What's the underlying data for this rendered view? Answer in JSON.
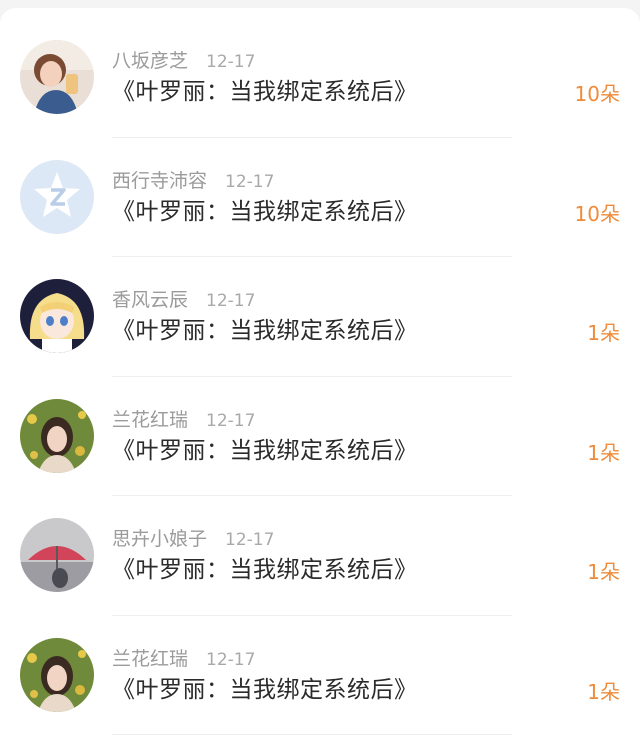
{
  "items": [
    {
      "name": "八坂彦芝",
      "date": "12-17",
      "book": "《叶罗丽：当我绑定系统后》",
      "amount": "10朵",
      "avatar_icon": "girl-photo-avatar"
    },
    {
      "name": "西行寺沛容",
      "date": "12-17",
      "book": "《叶罗丽：当我绑定系统后》",
      "amount": "10朵",
      "avatar_icon": "default-z-avatar"
    },
    {
      "name": "香风云辰",
      "date": "12-17",
      "book": "《叶罗丽：当我绑定系统后》",
      "amount": "1朵",
      "avatar_icon": "anime-girl-avatar"
    },
    {
      "name": "兰花红瑞",
      "date": "12-17",
      "book": "《叶罗丽：当我绑定系统后》",
      "amount": "1朵",
      "avatar_icon": "girl-flowers-avatar"
    },
    {
      "name": "思卉小娘子",
      "date": "12-17",
      "book": "《叶罗丽：当我绑定系统后》",
      "amount": "1朵",
      "avatar_icon": "umbrella-avatar"
    },
    {
      "name": "兰花红瑞",
      "date": "12-17",
      "book": "《叶罗丽：当我绑定系统后》",
      "amount": "1朵",
      "avatar_icon": "girl-flowers-avatar"
    }
  ],
  "colors": {
    "amount": "#ef8b3a",
    "name": "#9b9b9b",
    "book": "#2b2b2b"
  }
}
